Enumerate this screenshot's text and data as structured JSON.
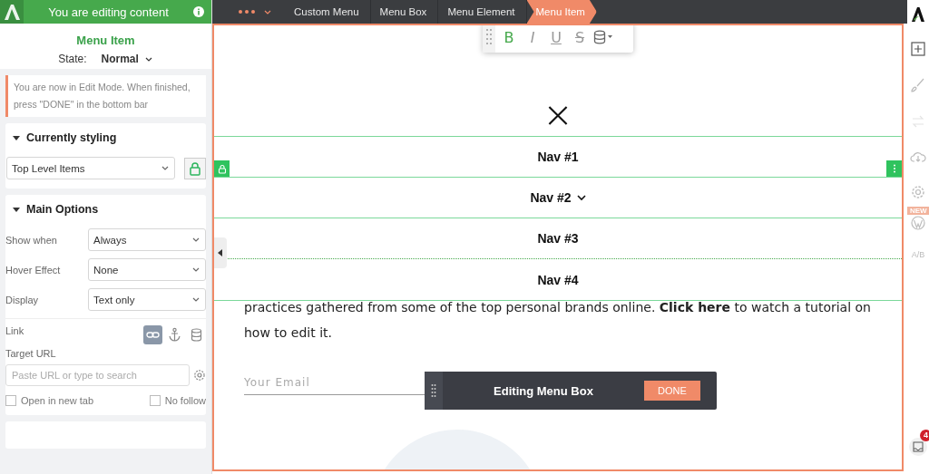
{
  "editor_header": {
    "title": "You are editing content"
  },
  "element": {
    "title": "Menu Item",
    "state_label": "State:",
    "state_value": "Normal"
  },
  "notice": "You are now in Edit Mode. When finished, press \"DONE\" in the bottom bar",
  "currently_styling": {
    "title": "Currently styling",
    "expanded": true,
    "select": "Top Level Items",
    "locked": true
  },
  "main_options": {
    "title": "Main Options",
    "expanded": true,
    "rows": [
      {
        "label": "Show when",
        "value": "Always"
      },
      {
        "label": "Hover Effect",
        "value": "None"
      },
      {
        "label": "Display",
        "value": "Text only"
      }
    ],
    "link": {
      "label": "Link",
      "modes": [
        {
          "kind": "link",
          "selected": true
        },
        {
          "kind": "anchor",
          "selected": false
        },
        {
          "kind": "dynamic",
          "selected": false
        }
      ]
    },
    "target_url": {
      "label": "Target URL",
      "placeholder": "Paste URL or type to search"
    },
    "checkboxes": [
      {
        "label": "Open in new tab",
        "checked": false
      },
      {
        "label": "No follow",
        "checked": false
      }
    ]
  },
  "breadcrumbs": [
    {
      "label": "Custom Menu",
      "selected": false
    },
    {
      "label": "Menu Box",
      "selected": false
    },
    {
      "label": "Menu Element",
      "selected": false
    },
    {
      "label": "Menu Item",
      "selected": true
    }
  ],
  "format_toolbar": [
    {
      "kind": "bold",
      "glyph": "B",
      "active": true
    },
    {
      "kind": "italic",
      "glyph": "I",
      "active": false
    },
    {
      "kind": "underline",
      "glyph": "U",
      "active": false
    },
    {
      "kind": "strike",
      "glyph": "S",
      "active": false
    }
  ],
  "nav_items": [
    {
      "label": "Nav #1",
      "selected": true,
      "has_submenu": false
    },
    {
      "label": "Nav #2",
      "selected": false,
      "has_submenu": true
    },
    {
      "label": "Nav #3",
      "selected": false,
      "has_submenu": false
    },
    {
      "label": "Nav #4",
      "selected": false,
      "has_submenu": false
    }
  ],
  "paragraph": "practices gathered from some of the top personal brands online. **Click here** to watch a tutorial on how to edit it.",
  "email": {
    "placeholder": "Your Email"
  },
  "bottom_bar": {
    "title": "Editing Menu Box",
    "button": "DONE"
  },
  "right_rail": {
    "new_badge": "NEW",
    "ab_label": "A/B",
    "notifications": "4"
  }
}
